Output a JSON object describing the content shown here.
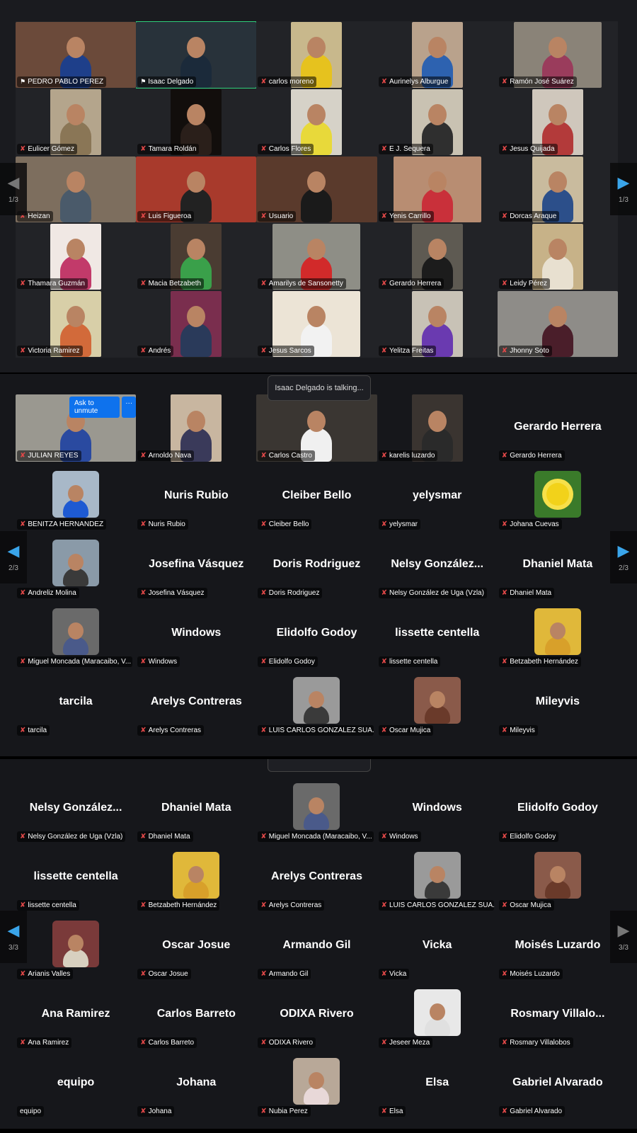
{
  "pages": [
    {
      "page_label": "1/3",
      "participants": [
        {
          "name": "PEDRO PABLO PEREZ",
          "icon": "pin-icon",
          "video": "wide",
          "bg": "#6b4a3a",
          "shirt": "#1e3f8a"
        },
        {
          "name": "Isaac Delgado",
          "icon": "pin-icon",
          "video": "wide",
          "bg": "#28323a",
          "shirt": "#1b2a3a",
          "active": true
        },
        {
          "name": "carlos moreno",
          "icon": "mic-off-icon",
          "video": "narrow",
          "bg": "#c8b88c",
          "shirt": "#e6c21e"
        },
        {
          "name": "Aurinelys Alburgue",
          "icon": "mic-off-icon",
          "video": "narrow",
          "bg": "#b9a28c",
          "shirt": "#2d62b0"
        },
        {
          "name": "Ramón José Suárez",
          "icon": "mic-off-icon",
          "video": "mid",
          "bg": "#8a8378",
          "shirt": "#9a3c5c"
        },
        {
          "name": "Eulicer Gómez",
          "icon": "mic-off-icon",
          "video": "narrow",
          "bg": "#b4a58c",
          "shirt": "#8a7656"
        },
        {
          "name": "Tamara Roldán",
          "icon": "mic-off-icon",
          "video": "narrow",
          "bg": "#120e0c",
          "shirt": "#2a1f1a"
        },
        {
          "name": "Carlos Flores",
          "icon": "mic-off-icon",
          "video": "narrow",
          "bg": "#d6d2c8",
          "shirt": "#e8d93a"
        },
        {
          "name": "E J. Sequera",
          "icon": "mic-off-icon",
          "video": "narrow",
          "bg": "#c9c2b2",
          "shirt": "#2f2f2f"
        },
        {
          "name": "Jesus Quijada",
          "icon": "mic-off-icon",
          "video": "narrow",
          "bg": "#cfc7bc",
          "shirt": "#b33a3a"
        },
        {
          "name": "Heizan",
          "icon": "mic-off-icon",
          "video": "wide",
          "bg": "#7d6e5e",
          "shirt": "#4a5a6a"
        },
        {
          "name": "Luis Figueroa",
          "icon": "mic-off-icon",
          "video": "wide",
          "bg": "#a83a2c",
          "shirt": "#222"
        },
        {
          "name": "Usuario",
          "icon": "mic-off-icon",
          "video": "wide",
          "bg": "#5a3a2c",
          "shirt": "#1a1a1a"
        },
        {
          "name": "Yenis Carrillo",
          "icon": "mic-off-icon",
          "video": "mid",
          "bg": "#b88d72",
          "shirt": "#c9303a"
        },
        {
          "name": "Dorcas Araque",
          "icon": "mic-off-icon",
          "video": "narrow",
          "bg": "#c9bb9e",
          "shirt": "#2c4f8a"
        },
        {
          "name": "Thamara Guzmán",
          "icon": "mic-off-icon",
          "video": "narrow",
          "bg": "#f0e8e4",
          "shirt": "#c23a6a"
        },
        {
          "name": "Macia Betzabeth",
          "icon": "mic-off-icon",
          "video": "narrow",
          "bg": "#4a3c32",
          "shirt": "#3aa04a"
        },
        {
          "name": "Amarilys de Sansonetty",
          "icon": "mic-off-icon",
          "video": "mid",
          "bg": "#8e8e86",
          "shirt": "#d22a2a"
        },
        {
          "name": "Gerardo Herrera",
          "icon": "mic-off-icon",
          "video": "narrow",
          "bg": "#5e5a52",
          "shirt": "#1c1c1c"
        },
        {
          "name": "Leidy Pérez",
          "icon": "mic-off-icon",
          "video": "narrow",
          "bg": "#c7b288",
          "shirt": "#e8e0d0"
        },
        {
          "name": "Victoria Ramirez",
          "icon": "mic-off-icon",
          "video": "narrow",
          "bg": "#d8cfa8",
          "shirt": "#d26a3a"
        },
        {
          "name": "Andrés",
          "icon": "mic-off-icon",
          "video": "narrow",
          "bg": "#7a2e4e",
          "shirt": "#2a3a5a"
        },
        {
          "name": "Jesus Sarcos",
          "icon": "mic-off-icon",
          "video": "mid",
          "bg": "#ece4d6",
          "shirt": "#f2f2f2"
        },
        {
          "name": "Yelitza Freitas",
          "icon": "mic-off-icon",
          "video": "narrow",
          "bg": "#c8c2b6",
          "shirt": "#6a3ab0"
        },
        {
          "name": "Jhonny Soto",
          "icon": "mic-off-icon",
          "video": "wide",
          "bg": "#8e8c88",
          "shirt": "#4a1e2a"
        }
      ]
    },
    {
      "page_label": "2/3",
      "participants": [
        {
          "name": "JULIAN REYES",
          "icon": "mic-off-icon",
          "video": "wide",
          "bg": "#9a9890",
          "shirt": "#2a4aa0",
          "unmute": true
        },
        {
          "name": "Arnoldo Nava",
          "icon": "mic-off-icon",
          "video": "narrow",
          "bg": "#c8b6a0",
          "shirt": "#3a3a5a"
        },
        {
          "name": "Carlos Castro",
          "icon": "mic-off-icon",
          "video": "wide",
          "bg": "#3a3632",
          "shirt": "#f0f0f0"
        },
        {
          "name": "karelis luzardo",
          "icon": "mic-off-icon",
          "video": "narrow",
          "bg": "#3a3430",
          "shirt": "#2a2a2a"
        },
        {
          "name": "Gerardo Herrera",
          "display": "Gerardo Herrera",
          "icon": "mic-off-icon"
        },
        {
          "name": "BENITZA HERNANDEZ",
          "icon": "mic-off-icon",
          "avatar": "#a8b8c8",
          "shirt": "#1e5ad2"
        },
        {
          "name": "Nuris Rubio",
          "display": "Nuris Rubio",
          "icon": "mic-off-icon"
        },
        {
          "name": "Cleiber  Bello",
          "display": "Cleiber  Bello",
          "icon": "mic-off-icon"
        },
        {
          "name": "yelysmar",
          "display": "yelysmar",
          "icon": "mic-off-icon"
        },
        {
          "name": "Johana Cuevas",
          "icon": "mic-off-icon",
          "avatar": "#3a7a2a",
          "flower": true
        },
        {
          "name": "Andreliz Molina",
          "icon": "mic-off-icon",
          "avatar": "#8a9aa8",
          "shirt": "#3a3a3a"
        },
        {
          "name": "Josefina Vásquez",
          "display": "Josefina Vásquez",
          "icon": "mic-off-icon"
        },
        {
          "name": "Doris Rodriguez",
          "display": "Doris Rodriguez",
          "icon": "mic-off-icon"
        },
        {
          "name": "Nelsy González de Uga (Vzla)",
          "display": "Nelsy  González...",
          "icon": "mic-off-icon"
        },
        {
          "name": "Dhaniel Mata",
          "display": "Dhaniel Mata",
          "icon": "mic-off-icon"
        },
        {
          "name": "Miguel Moncada (Maracaibo, V...",
          "icon": "mic-off-icon",
          "avatar": "#6a6a6a",
          "shirt": "#4a5a8a"
        },
        {
          "name": "Windows",
          "display": "Windows",
          "icon": "mic-off-icon"
        },
        {
          "name": "Elidolfo Godoy",
          "display": "Elidolfo Godoy",
          "icon": "mic-off-icon"
        },
        {
          "name": "lissette centella",
          "display": "lissette centella",
          "icon": "mic-off-icon"
        },
        {
          "name": "Betzabeth Hernández",
          "icon": "mic-off-icon",
          "avatar": "#e0b83a",
          "shirt": "#d8a02a"
        },
        {
          "name": "tarcila",
          "display": "tarcila",
          "icon": "mic-off-icon"
        },
        {
          "name": "Arelys Contreras",
          "display": "Arelys Contreras",
          "icon": "mic-off-icon"
        },
        {
          "name": "LUIS CARLOS GONZALEZ SUA...",
          "icon": "mic-off-icon",
          "avatar": "#9a9a9a",
          "shirt": "#3a3a3a"
        },
        {
          "name": "Oscar Mujica",
          "icon": "mic-off-icon",
          "avatar": "#8a5a4a",
          "shirt": "#6a3a2a"
        },
        {
          "name": "Mileyvis",
          "display": "Mileyvis",
          "icon": "mic-off-icon"
        }
      ]
    },
    {
      "page_label": "3/3",
      "participants": [
        {
          "name": "Nelsy González de Uga (Vzla)",
          "display": "Nelsy  González...",
          "icon": "mic-off-icon"
        },
        {
          "name": "Dhaniel Mata",
          "display": "Dhaniel Mata",
          "icon": "mic-off-icon"
        },
        {
          "name": "Miguel Moncada (Maracaibo, V...",
          "icon": "mic-off-icon",
          "avatar": "#6a6a6a",
          "shirt": "#4a5a8a"
        },
        {
          "name": "Windows",
          "display": "Windows",
          "icon": "mic-off-icon"
        },
        {
          "name": "Elidolfo Godoy",
          "display": "Elidolfo Godoy",
          "icon": "mic-off-icon"
        },
        {
          "name": "lissette centella",
          "display": "lissette centella",
          "icon": "mic-off-icon"
        },
        {
          "name": "Betzabeth Hernández",
          "icon": "mic-off-icon",
          "avatar": "#e0b83a",
          "shirt": "#d8a02a"
        },
        {
          "name": "Arelys Contreras",
          "display": "Arelys Contreras",
          "icon": "mic-off-icon"
        },
        {
          "name": "LUIS CARLOS GONZALEZ SUA...",
          "icon": "mic-off-icon",
          "avatar": "#9a9a9a",
          "shirt": "#3a3a3a"
        },
        {
          "name": "Oscar Mujica",
          "icon": "mic-off-icon",
          "avatar": "#8a5a4a",
          "shirt": "#6a3a2a"
        },
        {
          "name": "Arianis Valles",
          "icon": "mic-off-icon",
          "avatar": "#7a3a3a",
          "shirt": "#d8d0c0"
        },
        {
          "name": "Oscar Josue",
          "display": "Oscar Josue",
          "icon": "mic-off-icon"
        },
        {
          "name": "Armando Gil",
          "display": "Armando Gil",
          "icon": "mic-off-icon"
        },
        {
          "name": "Vicka",
          "display": "Vicka",
          "icon": "mic-off-icon"
        },
        {
          "name": "Moisés Luzardo",
          "display": "Moisés Luzardo",
          "icon": "mic-off-icon"
        },
        {
          "name": "Ana Ramirez",
          "display": "Ana Ramirez",
          "icon": "mic-off-icon"
        },
        {
          "name": "Carlos Barreto",
          "display": "Carlos Barreto",
          "icon": "mic-off-icon"
        },
        {
          "name": "ODIXA Rivero",
          "display": "ODIXA Rivero",
          "icon": "mic-off-icon"
        },
        {
          "name": "Jeseer Meza",
          "icon": "mic-off-icon",
          "avatar": "#e8e8e8",
          "shirt": "#e0e0e0"
        },
        {
          "name": "Rosmary Villalobos",
          "display": "Rosmary  Villalo...",
          "icon": "mic-off-icon"
        },
        {
          "name": "equipo",
          "display": "equipo",
          "icon": "none"
        },
        {
          "name": "Johana",
          "display": "Johana",
          "icon": "mic-off-icon"
        },
        {
          "name": "Nubia Perez",
          "icon": "mic-off-icon",
          "avatar": "#b8a898",
          "shirt": "#e8d8d8"
        },
        {
          "name": "Elsa",
          "display": "Elsa",
          "icon": "mic-off-icon"
        },
        {
          "name": "Gabriel Alvarado",
          "display": "Gabriel Alvarado",
          "icon": "mic-off-icon"
        }
      ]
    }
  ],
  "nav": {
    "prev_icon": "chevron-left-icon",
    "next_icon": "chevron-right-icon",
    "active_color": "#3aa5ea",
    "disabled_color": "#777777"
  },
  "tooltip": {
    "text": "Isaac Delgado is talking..."
  },
  "unmute": {
    "label": "Ask to unmute",
    "more": "···"
  },
  "colors": {
    "active_speaker": "#2ecf7a",
    "muted": "#e04848",
    "background": "#16171b"
  }
}
